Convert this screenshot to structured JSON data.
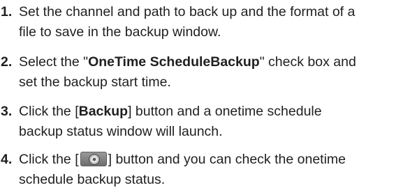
{
  "steps": [
    {
      "number": "1.",
      "lines": [
        "Set the channel and path to back up and the format of a",
        "file to save in the backup window."
      ]
    },
    {
      "number": "2.",
      "line1_pre": "Select the \"",
      "line1_bold": "OneTime ScheduleBackup",
      "line1_post": "\" check box and",
      "line2": "set the backup start time."
    },
    {
      "number": "3.",
      "line1_pre": "Click the [",
      "line1_bold": "Backup",
      "line1_post": "] button and a onetime schedule",
      "line2": "backup status window will launch."
    },
    {
      "number": "4.",
      "line1_pre": "Click the [",
      "line1_icon": "backup-status-disc-icon",
      "line1_post": "] button and you can check the onetime",
      "line2": "schedule backup status."
    }
  ]
}
